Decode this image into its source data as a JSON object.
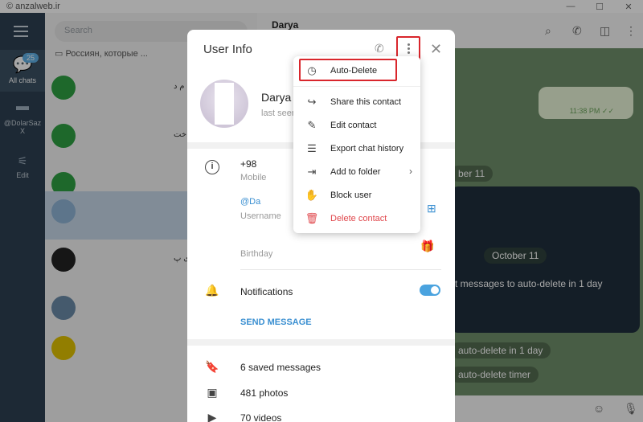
{
  "watermark": "© anzalweb.ir",
  "window_controls": {
    "minimize": "—",
    "maximize": "☐",
    "close": "✕"
  },
  "rail": {
    "all_chats_label": "All chats",
    "all_chats_badge": "25",
    "folder_label": "@DolarSaz",
    "folder_sub": "X",
    "edit_label": "Edit"
  },
  "chatlist": {
    "search_placeholder": "Search",
    "pinned_preview": "Россиян, которые ...",
    "rows": [
      {
        "rtl": "م د"
      },
      {
        "rtl": "خت"
      },
      {
        "rtl": ""
      },
      {
        "rtl": ""
      },
      {
        "rtl": "ی پ"
      },
      {
        "rtl": ""
      },
      {
        "rtl": ""
      }
    ]
  },
  "chat": {
    "title": "Darya",
    "outgoing_time": "11:38 PM ✓✓",
    "date_chip_1": "ber 11",
    "date_chip_2": "October 11",
    "sys_line_1": "t messages to auto-delete in 1 day",
    "sys_line_2": "auto-delete in 1 day",
    "sys_line_3": "auto-delete timer"
  },
  "modal": {
    "title": "User Info",
    "name": "Darya",
    "status": "last seen",
    "phone": "+98",
    "phone_label": "Mobile",
    "username": "@Da",
    "username_label": "Username",
    "birthday_label": "Birthday",
    "notifications_label": "Notifications",
    "notifications_on": true,
    "send_message": "SEND MESSAGE",
    "saved_messages": "6 saved messages",
    "photos": "481 photos",
    "videos": "70 videos"
  },
  "dropdown": {
    "items": [
      {
        "label": "Auto-Delete",
        "icon": "timer-icon"
      },
      {
        "label": "Share this contact",
        "icon": "share-icon"
      },
      {
        "label": "Edit contact",
        "icon": "pencil-icon"
      },
      {
        "label": "Export chat history",
        "icon": "export-icon"
      },
      {
        "label": "Add to folder",
        "icon": "folder-add-icon"
      },
      {
        "label": "Block user",
        "icon": "hand-icon"
      },
      {
        "label": "Delete contact",
        "icon": "trash-icon"
      }
    ]
  },
  "colors": {
    "accent": "#3a8fd1",
    "danger": "#e0474c",
    "highlight_box": "#d9262c"
  }
}
